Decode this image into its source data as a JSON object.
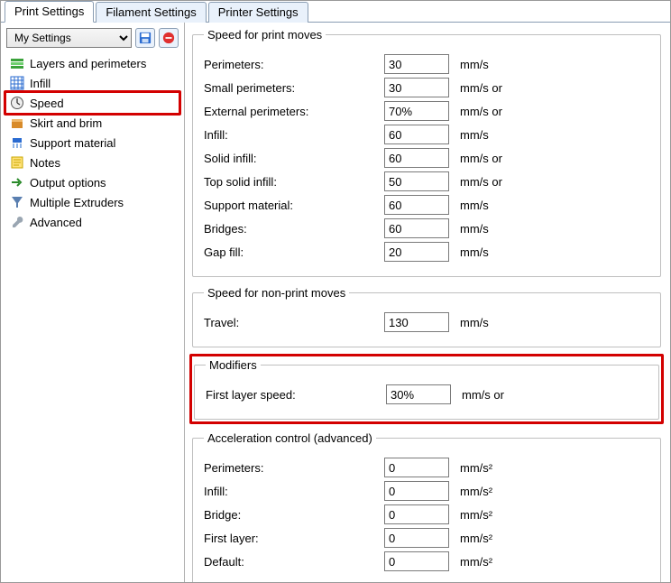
{
  "tabs": {
    "print": "Print Settings",
    "filament": "Filament Settings",
    "printer": "Printer Settings"
  },
  "sidebar": {
    "profile": "My Settings",
    "items": [
      {
        "label": "Layers and perimeters"
      },
      {
        "label": "Infill"
      },
      {
        "label": "Speed"
      },
      {
        "label": "Skirt and brim"
      },
      {
        "label": "Support material"
      },
      {
        "label": "Notes"
      },
      {
        "label": "Output options"
      },
      {
        "label": "Multiple Extruders"
      },
      {
        "label": "Advanced"
      }
    ]
  },
  "groups": {
    "print_moves": {
      "legend": "Speed for print moves"
    },
    "non_print": {
      "legend": "Speed for non-print moves"
    },
    "modifiers": {
      "legend": "Modifiers"
    },
    "accel": {
      "legend": "Acceleration control (advanced)"
    }
  },
  "rows": {
    "perimeters": {
      "label": "Perimeters:",
      "value": "30",
      "unit": "mm/s"
    },
    "small_perimeters": {
      "label": "Small perimeters:",
      "value": "30",
      "unit": "mm/s or"
    },
    "ext_perimeters": {
      "label": "External perimeters:",
      "value": "70%",
      "unit": "mm/s or"
    },
    "infill": {
      "label": "Infill:",
      "value": "60",
      "unit": "mm/s"
    },
    "solid_infill": {
      "label": "Solid infill:",
      "value": "60",
      "unit": "mm/s or"
    },
    "top_solid": {
      "label": "Top solid infill:",
      "value": "50",
      "unit": "mm/s or"
    },
    "support": {
      "label": "Support material:",
      "value": "60",
      "unit": "mm/s"
    },
    "bridges": {
      "label": "Bridges:",
      "value": "60",
      "unit": "mm/s"
    },
    "gap_fill": {
      "label": "Gap fill:",
      "value": "20",
      "unit": "mm/s"
    },
    "travel": {
      "label": "Travel:",
      "value": "130",
      "unit": "mm/s"
    },
    "first_layer": {
      "label": "First layer speed:",
      "value": "30%",
      "unit": "mm/s or"
    },
    "a_perimeters": {
      "label": "Perimeters:",
      "value": "0",
      "unit": "mm/s²"
    },
    "a_infill": {
      "label": "Infill:",
      "value": "0",
      "unit": "mm/s²"
    },
    "a_bridge": {
      "label": "Bridge:",
      "value": "0",
      "unit": "mm/s²"
    },
    "a_firstlayer": {
      "label": "First layer:",
      "value": "0",
      "unit": "mm/s²"
    },
    "a_default": {
      "label": "Default:",
      "value": "0",
      "unit": "mm/s²"
    }
  }
}
